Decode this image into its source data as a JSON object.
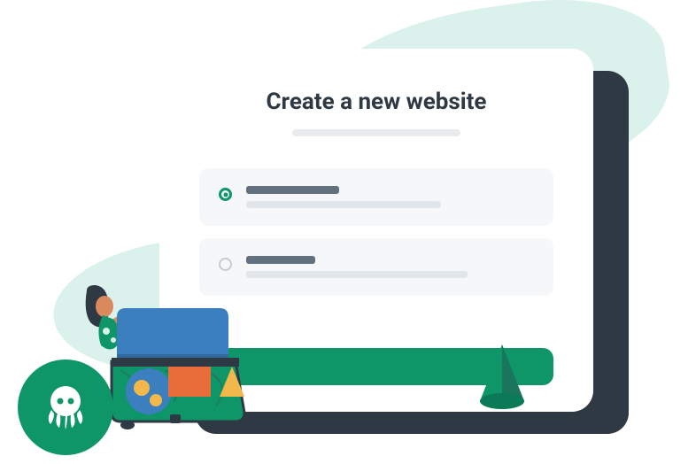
{
  "card": {
    "title": "Create a new website",
    "option1_selected": true,
    "option2_selected": false
  },
  "colors": {
    "primary": "#0e9568",
    "dark": "#2f3944",
    "mint": "#daf2eb",
    "skeleton_dark": "#63707d",
    "skeleton_light": "#e1e6ea"
  },
  "icons": {
    "logo": "octopus-icon"
  }
}
